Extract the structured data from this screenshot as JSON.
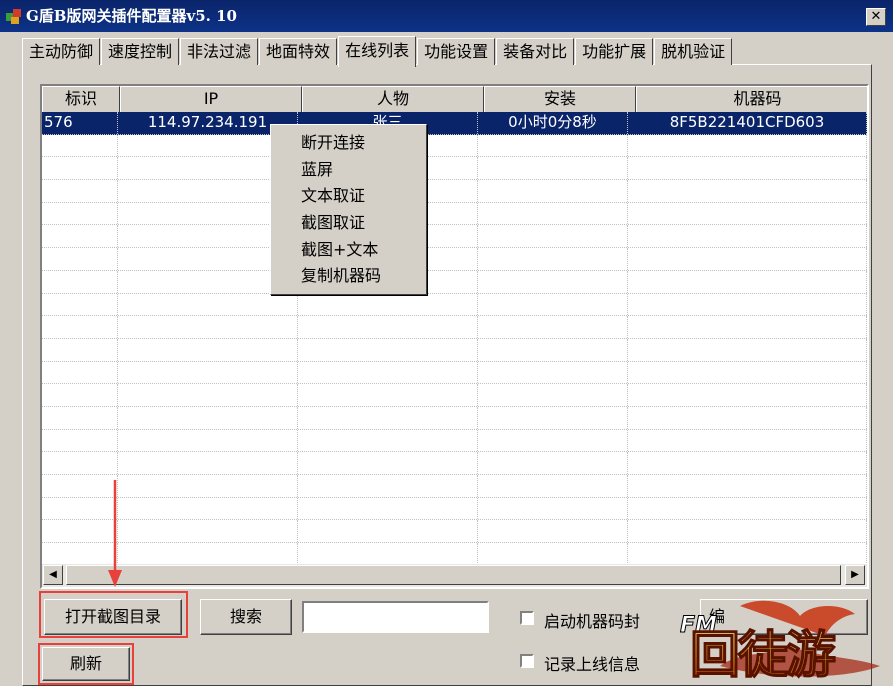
{
  "window": {
    "title": "G盾B版网关插件配置器v5. 10",
    "close_label": "✕"
  },
  "tabs": [
    {
      "label": "主动防御"
    },
    {
      "label": "速度控制"
    },
    {
      "label": "非法过滤"
    },
    {
      "label": "地面特效"
    },
    {
      "label": "在线列表",
      "active": true
    },
    {
      "label": "功能设置"
    },
    {
      "label": "装备对比"
    },
    {
      "label": "功能扩展"
    },
    {
      "label": "脱机验证"
    }
  ],
  "list": {
    "columns": [
      "标识",
      "IP",
      "人物",
      "安装",
      "机器码"
    ],
    "rows": [
      {
        "id": "576",
        "ip": "114.97.234.191",
        "name": "张三",
        "install": "0小时0分8秒",
        "machine": "8F5B221401CFD603"
      }
    ]
  },
  "context_menu": {
    "items": [
      "断开连接",
      "蓝屏",
      "文本取证",
      "截图取证",
      "截图+文本",
      "复制机器码"
    ]
  },
  "controls": {
    "open_screenshot_dir": "打开截图目录",
    "search": "搜索",
    "search_value": "",
    "refresh": "刷新",
    "machine_code_ban": "启动机器码封",
    "log_online": "记录上线信息",
    "partial_hidden_button": "编"
  },
  "logo": {
    "text": "FM 回徒游"
  },
  "colors": {
    "titlebar": "#0a246a",
    "annotation": "#e8413b",
    "selection": "#0a246a"
  }
}
